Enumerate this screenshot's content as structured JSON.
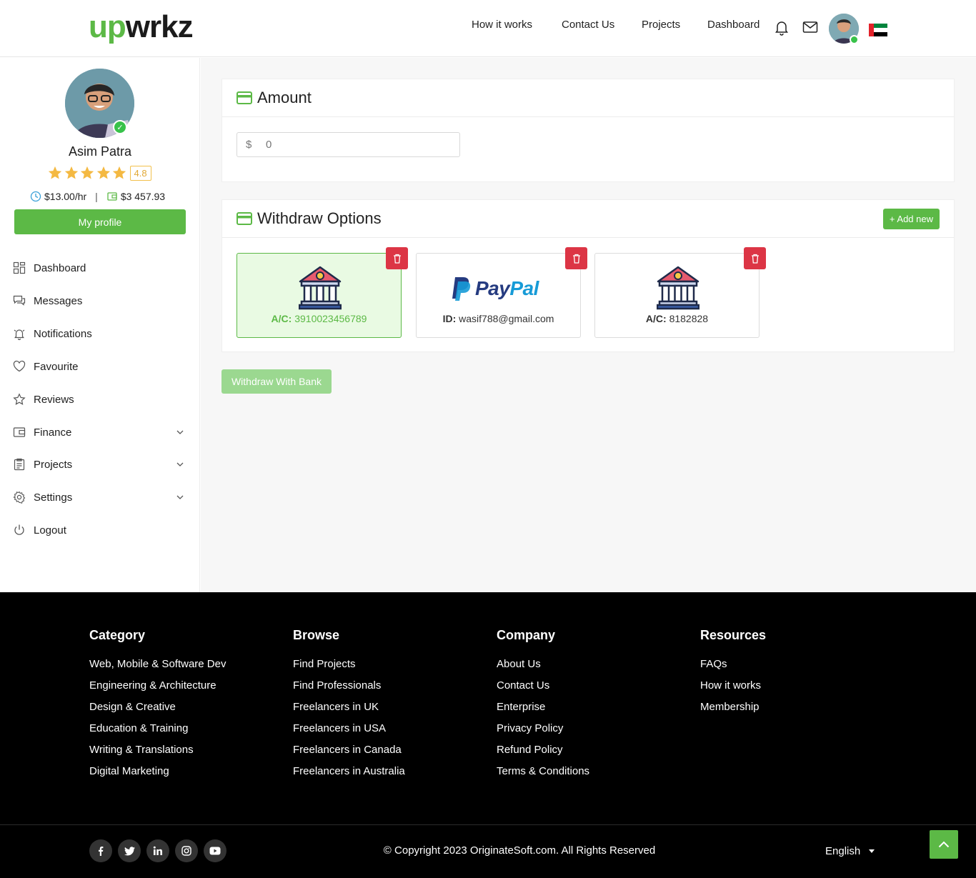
{
  "header": {
    "logo_up": "up",
    "logo_rest": "wrkz",
    "nav": [
      "How it works",
      "Contact Us",
      "Projects",
      "Dashboard"
    ],
    "icons": [
      "bell-icon",
      "mail-icon"
    ],
    "flag": "UAE",
    "colors": {
      "brand": "#5cb946"
    }
  },
  "profile": {
    "name": "Asim Patra",
    "rating": "4.8",
    "stars": 5,
    "hourly_rate": "$13.00/hr",
    "balance": "$3 457.93",
    "my_profile_label": "My profile"
  },
  "sidebar": {
    "items": [
      {
        "label": "Dashboard",
        "icon": "dashboard-icon"
      },
      {
        "label": "Messages",
        "icon": "messages-icon"
      },
      {
        "label": "Notifications",
        "icon": "bell-icon"
      },
      {
        "label": "Favourite",
        "icon": "heart-icon"
      },
      {
        "label": "Reviews",
        "icon": "star-icon"
      },
      {
        "label": "Finance",
        "icon": "wallet-icon"
      },
      {
        "label": "Projects",
        "icon": "clipboard-icon"
      },
      {
        "label": "Settings",
        "icon": "gear-icon"
      },
      {
        "label": "Logout",
        "icon": "power-icon"
      }
    ]
  },
  "amount": {
    "title": "Amount",
    "currency": "$",
    "value": "0"
  },
  "withdraw": {
    "title": "Withdraw Options",
    "add_new": "+ Add new",
    "options": [
      {
        "type": "bank",
        "label_key": "A/C:",
        "label_value": "3910023456789",
        "selected": true
      },
      {
        "type": "paypal",
        "label_key": "ID:",
        "label_value": "wasif788@gmail.com",
        "selected": false
      },
      {
        "type": "bank",
        "label_key": "A/C:",
        "label_value": "8182828",
        "selected": false
      }
    ],
    "paypal_word": "PayPal",
    "button": "Withdraw With Bank"
  },
  "footer": {
    "columns": [
      {
        "title": "Category",
        "links": [
          "Web, Mobile & Software Dev",
          "Engineering & Architecture",
          "Design & Creative",
          "Education & Training",
          "Writing & Translations",
          "Digital Marketing"
        ]
      },
      {
        "title": "Browse",
        "links": [
          "Find Projects",
          "Find Professionals",
          "Freelancers in UK",
          "Freelancers in USA",
          "Freelancers in Canada",
          "Freelancers in Australia"
        ]
      },
      {
        "title": "Company",
        "links": [
          "About Us",
          "Contact Us",
          "Enterprise",
          "Privacy Policy",
          "Refund Policy",
          "Terms & Conditions"
        ]
      },
      {
        "title": "Resources",
        "links": [
          "FAQs",
          "How it works",
          "Membership"
        ]
      }
    ],
    "socials": [
      "facebook-icon",
      "twitter-icon",
      "linkedin-icon",
      "instagram-icon",
      "youtube-icon"
    ],
    "copyright": "© Copyright 2023 OriginateSoft.com. All Rights Reserved",
    "language": "English"
  }
}
